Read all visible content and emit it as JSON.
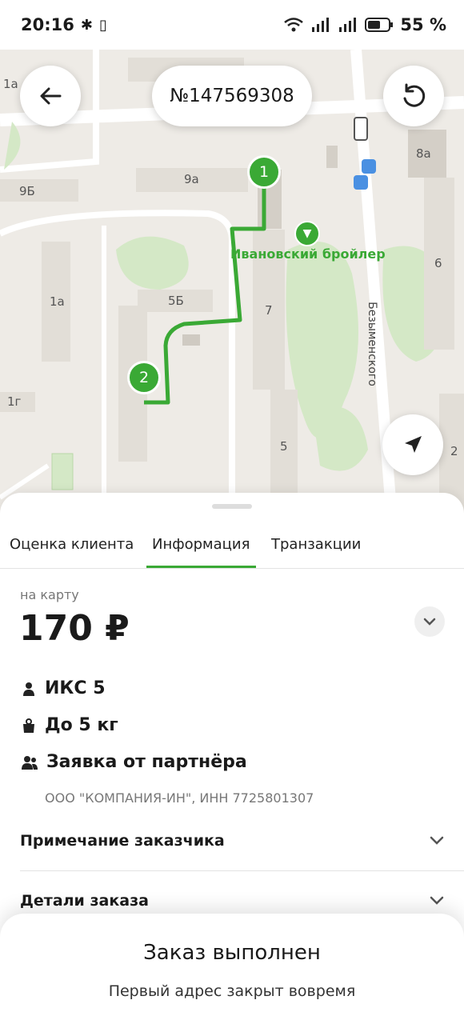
{
  "status_bar": {
    "time": "20:16",
    "battery": "55 %"
  },
  "map": {
    "order_number": "№147569308",
    "labels": {
      "b1a_top": "1а",
      "b9b": "9Б",
      "b9a": "9а",
      "b8a": "8а",
      "b1a": "1а",
      "b5b": "5Б",
      "b7": "7",
      "b6": "6",
      "b1g": "1г",
      "b5": "5",
      "b2": "2",
      "street": "Безыменского",
      "poi": "Ивановский бройлер"
    },
    "pins": [
      "1",
      "2"
    ],
    "accent": "#3aa935"
  },
  "tabs": [
    "Оценка клиента",
    "Информация",
    "Транзакции"
  ],
  "payment": {
    "label": "на карту",
    "amount": "170 ₽"
  },
  "info": {
    "tariff": "ИКС 5",
    "weight": "До 5 кг",
    "source": "Заявка от партнёра",
    "company": "ООО \"КОМПАНИЯ-ИН\", ИНН 7725801307"
  },
  "sections": {
    "note": "Примечание заказчика",
    "details": "Детали заказа"
  },
  "toast": {
    "title": "Заказ выполнен",
    "subtitle": "Первый адрес закрыт вовремя"
  }
}
